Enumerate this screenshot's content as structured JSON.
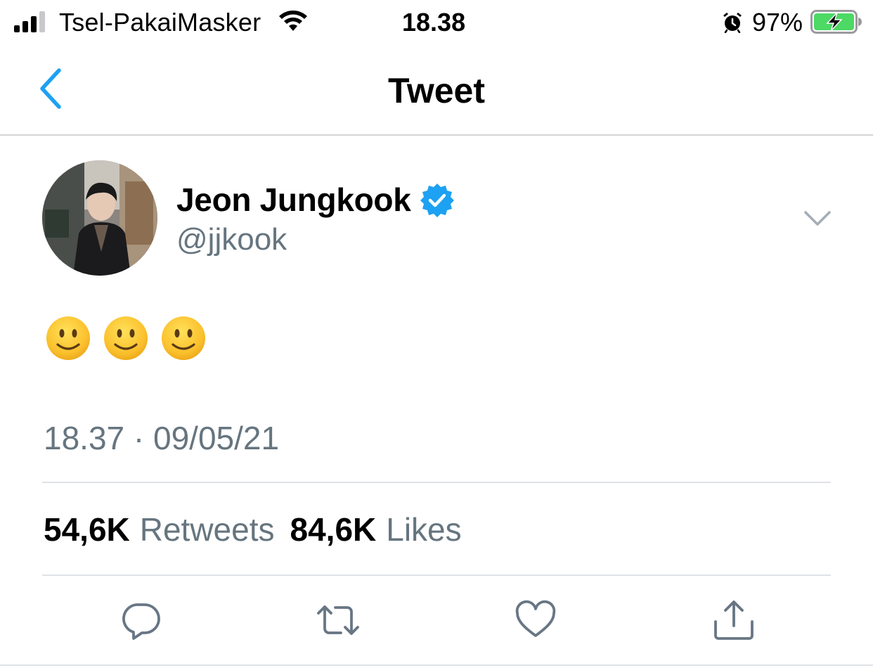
{
  "status_bar": {
    "carrier": "Tsel-PakaiMasker",
    "time": "18.38",
    "battery_percent": "97%",
    "signal_bars": 3,
    "battery_level": 0.97,
    "charging": true,
    "icons": [
      "signal-icon",
      "wifi-icon",
      "alarm-icon",
      "battery-charging-icon"
    ]
  },
  "nav": {
    "title": "Tweet",
    "back_icon": "chevron-left-icon"
  },
  "tweet": {
    "author_name": "Jeon Jungkook",
    "handle": "@jjkook",
    "verified": true,
    "text": "🙂🙂🙂",
    "emojis": [
      "slightly-smiling-face",
      "slightly-smiling-face",
      "slightly-smiling-face"
    ],
    "timestamp": "18.37 · 09/05/21",
    "stats": {
      "retweets_count": "54,6K",
      "retweets_label": "Retweets",
      "likes_count": "84,6K",
      "likes_label": "Likes"
    }
  },
  "actions": [
    "reply-icon",
    "retweet-icon",
    "like-icon",
    "share-icon"
  ],
  "colors": {
    "accent": "#1DA1F2",
    "secondary_text": "#66757f",
    "divider": "#dfe2e6",
    "battery_green": "#4cd964"
  }
}
